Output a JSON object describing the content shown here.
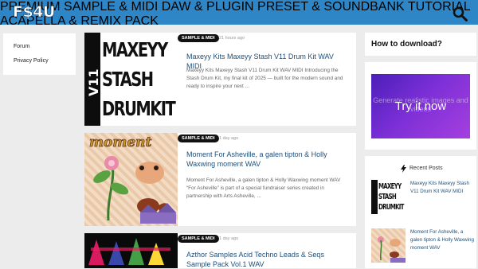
{
  "logo": {
    "text": "F$4U"
  },
  "nav": {
    "items": [
      "PREMIUM",
      "SAMPLE & MIDI",
      "DAW & PLUGIN",
      "PRESET & SOUNDBANK",
      "TUTORIAL",
      "ACAPELLA & REMIX PACK"
    ]
  },
  "sidebar_left": {
    "links": [
      "Forum",
      "Privacy Policy"
    ]
  },
  "posts": [
    {
      "badge": "SAMPLE & MIDI",
      "time": "21 hours ago",
      "title": "Maxeyy Kits Maxeyy Stash V11 Drum Kit WAV MIDI",
      "excerpt": "Maxeyy Kits Maxeyy Stash V11 Drum Kit WAV MIDI Introducing the Stash Drum Kit, my final kit of 2025 — built for the modern sound and ready to inspire your next ...",
      "thumb": {
        "side": "V11",
        "lines": [
          "MAXEYY",
          "STASH",
          "DRUMKIT"
        ]
      }
    },
    {
      "badge": "SAMPLE & MIDI",
      "time": "1 day ago",
      "title": "Moment For Asheville, a galen tipton & Holly Waxwing moment WAV",
      "excerpt": "Moment For Asheville, a galen tipton & Holly Waxwing moment WAV “For Asheville” is part of a special fundraiser series created in partnership with Arts Asheville, ...",
      "thumb": {
        "word": "moment"
      }
    },
    {
      "badge": "SAMPLE & MIDI",
      "time": "1 day ago",
      "title": "Azthor Samples Acid Techno Leads & Seqs Sample Pack Vol.1 WAV",
      "excerpt": ""
    }
  ],
  "right": {
    "howto": "How to download?",
    "ad": {
      "bg_text": "Generate realistic images and videos",
      "cta": "Try it now"
    },
    "recent_title": "Recent Posts",
    "recent": [
      {
        "title": "Maxeyy Kits Maxeyy Stash V11 Drum Kit WAV MIDI"
      },
      {
        "title": "Moment For Asheville, a galen tipton & Holly Waxwing moment WAV"
      }
    ]
  },
  "colors": {
    "topbar": "#2f86c6",
    "accent_title": "#1f4f7a",
    "badge": "#111111"
  }
}
